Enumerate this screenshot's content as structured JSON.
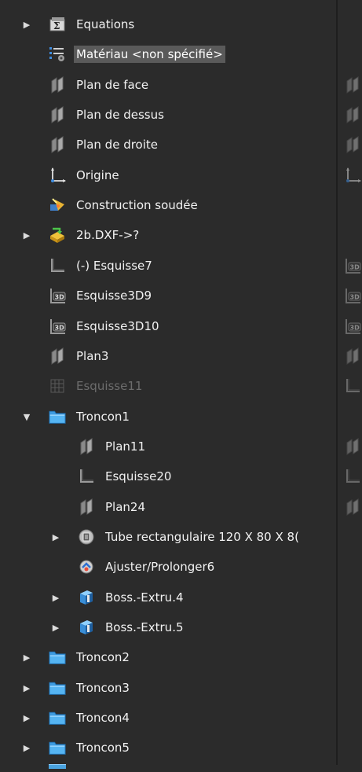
{
  "tree": {
    "items": [
      {
        "label": "Equations",
        "icon": "equations-icon",
        "expand": "collapsed",
        "level": 0
      },
      {
        "label": "Matériau <non spécifié>",
        "icon": "material-icon",
        "expand": "none",
        "level": 0,
        "selected": true
      },
      {
        "label": "Plan de face",
        "icon": "plane-icon",
        "expand": "none",
        "level": 0
      },
      {
        "label": "Plan de dessus",
        "icon": "plane-icon",
        "expand": "none",
        "level": 0
      },
      {
        "label": "Plan de droite",
        "icon": "plane-icon",
        "expand": "none",
        "level": 0
      },
      {
        "label": "Origine",
        "icon": "origin-icon",
        "expand": "none",
        "level": 0
      },
      {
        "label": "Construction soudée",
        "icon": "weldment-icon",
        "expand": "none",
        "level": 0
      },
      {
        "label": "2b.DXF->?",
        "icon": "imported-part-icon",
        "expand": "collapsed",
        "level": 0
      },
      {
        "label": "(-) Esquisse7",
        "icon": "sketch-icon",
        "expand": "none",
        "level": 0
      },
      {
        "label": "Esquisse3D9",
        "icon": "sketch-3d-icon",
        "expand": "none",
        "level": 0
      },
      {
        "label": "Esquisse3D10",
        "icon": "sketch-3d-icon",
        "expand": "none",
        "level": 0
      },
      {
        "label": "Plan3",
        "icon": "plane-icon",
        "expand": "none",
        "level": 0
      },
      {
        "label": "Esquisse11",
        "icon": "grid-sketch-icon",
        "expand": "none",
        "level": 0,
        "dimmed": true
      },
      {
        "label": "Troncon1",
        "icon": "folder-icon",
        "expand": "expanded",
        "level": 0
      },
      {
        "label": "Plan11",
        "icon": "plane-icon",
        "expand": "none",
        "level": 1
      },
      {
        "label": "Esquisse20",
        "icon": "sketch-icon",
        "expand": "none",
        "level": 1
      },
      {
        "label": "Plan24",
        "icon": "plane-icon",
        "expand": "none",
        "level": 1
      },
      {
        "label": "Tube rectangulaire 120 X 80 X 8(",
        "icon": "structural-member-icon",
        "expand": "collapsed",
        "level": 1
      },
      {
        "label": "Ajuster/Prolonger6",
        "icon": "trim-extend-icon",
        "expand": "none",
        "level": 1
      },
      {
        "label": "Boss.-Extru.4",
        "icon": "extrude-icon",
        "expand": "collapsed",
        "level": 1
      },
      {
        "label": "Boss.-Extru.5",
        "icon": "extrude-icon",
        "expand": "collapsed",
        "level": 1
      },
      {
        "label": "Troncon2",
        "icon": "folder-icon",
        "expand": "collapsed",
        "level": 0
      },
      {
        "label": "Troncon3",
        "icon": "folder-icon",
        "expand": "collapsed",
        "level": 0
      },
      {
        "label": "Troncon4",
        "icon": "folder-icon",
        "expand": "collapsed",
        "level": 0
      },
      {
        "label": "Troncon5",
        "icon": "folder-icon",
        "expand": "collapsed",
        "level": 0
      }
    ]
  },
  "right_pane": {
    "ghost_icons": [
      {
        "row": 2,
        "icon": "plane-icon"
      },
      {
        "row": 3,
        "icon": "plane-icon"
      },
      {
        "row": 4,
        "icon": "plane-icon"
      },
      {
        "row": 5,
        "icon": "origin-icon"
      },
      {
        "row": 8,
        "icon": "sketch-3d-icon"
      },
      {
        "row": 9,
        "icon": "sketch-3d-icon"
      },
      {
        "row": 10,
        "icon": "sketch-3d-icon"
      },
      {
        "row": 11,
        "icon": "plane-icon"
      },
      {
        "row": 12,
        "icon": "sketch-icon"
      },
      {
        "row": 14,
        "icon": "plane-icon"
      },
      {
        "row": 15,
        "icon": "sketch-icon"
      },
      {
        "row": 16,
        "icon": "plane-icon"
      }
    ]
  },
  "colors": {
    "background": "#2b2b2b",
    "selection": "#5a5a5a",
    "folder": "#4aa3df",
    "text": "#f2f2f2",
    "dimmed_text": "#6c6c6c"
  }
}
